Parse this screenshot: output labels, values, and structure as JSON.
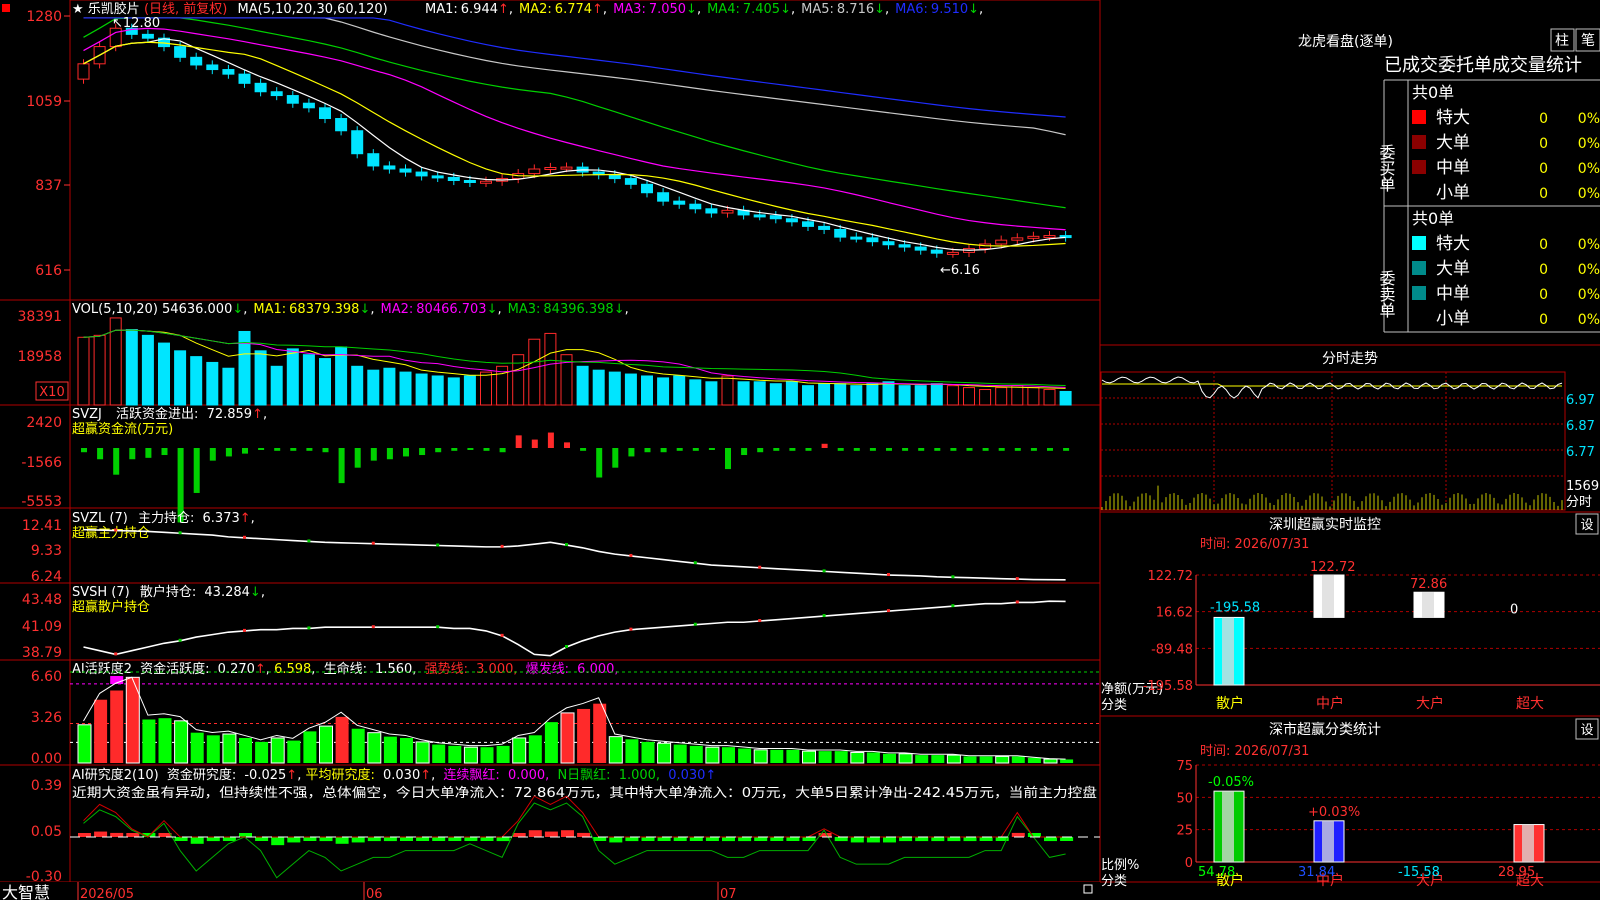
{
  "colors": {
    "up": "#ff2a2a",
    "down": "#00e5ff",
    "grid": "#b00000",
    "axis": "#ff3030",
    "ma1": "#ffffff",
    "ma2": "#ffff00",
    "ma3": "#ff00ff",
    "ma4": "#00d000",
    "ma5": "#c8c8c8",
    "ma6": "#1f2dff",
    "sell_med": "#008b8b",
    "buy_med": "#8b0000"
  },
  "panels": {
    "price": {
      "title_star": "★",
      "stock_name": "乐凯胶片",
      "period_note": "(日线, 前复权)",
      "ma_params": "MA(5,10,20,30,60,120)",
      "ma_values": [
        {
          "label": "MA1:",
          "value": "6.944",
          "arrow": "↑",
          "color": "#ffffff"
        },
        {
          "label": "MA2:",
          "value": "6.774",
          "arrow": "↑",
          "color": "#ffff00"
        },
        {
          "label": "MA3:",
          "value": "7.050",
          "arrow": "↓",
          "color": "#ff00ff"
        },
        {
          "label": "MA4:",
          "value": "7.405",
          "arrow": "↓",
          "color": "#00d000"
        },
        {
          "label": "MA5:",
          "value": "8.716",
          "arrow": "↓",
          "color": "#c8c8c8"
        },
        {
          "label": "MA6:",
          "value": "9.510",
          "arrow": "↓",
          "color": "#1f2dff"
        }
      ],
      "yticks": [
        "1280",
        "1059",
        "837",
        "616"
      ],
      "high_label": "12.80",
      "low_label": "←6.16"
    },
    "vol": {
      "label": "VOL(5,10,20)",
      "value": "54636.000",
      "value_arrow": "↓",
      "ma_values": [
        {
          "label": "MA1:",
          "value": "68379.398",
          "arrow": "↓",
          "color": "#ffff00"
        },
        {
          "label": "MA2:",
          "value": "80466.703",
          "arrow": "↓",
          "color": "#ff00ff"
        },
        {
          "label": "MA3:",
          "value": "84396.398",
          "arrow": "↓",
          "color": "#00d000"
        }
      ],
      "yticks": [
        "38391",
        "18958"
      ],
      "unit_badge": "X10"
    },
    "svzj": {
      "label": "SVZJ",
      "desc": "活跃资金进出:",
      "value": "72.859",
      "arrow": "↑",
      "sub": "超赢资金流(万元)",
      "yticks": [
        "2420",
        "-1566",
        "-5553"
      ]
    },
    "svzl": {
      "label": "SVZL (7)",
      "desc": "主力持仓:",
      "value": "6.373",
      "arrow": "↑",
      "sub": "超赢主力持仓",
      "yticks": [
        "12.41",
        "9.33",
        "6.24"
      ]
    },
    "svsh": {
      "label": "SVSH (7)",
      "desc": "散户持仓:",
      "value": "43.284",
      "arrow": "↓",
      "sub": "超赢散户持仓",
      "yticks": [
        "43.48",
        "41.09",
        "38.79"
      ]
    },
    "ai1": {
      "label": "AI活跃度2",
      "desc": "资金活跃度:",
      "value": "0.270",
      "v2": "6.598",
      "desc3": "生命线:",
      "v3": "1.560",
      "desc4": "强势线:",
      "v4": "3.000",
      "desc5": "爆发线:",
      "v5": "6.000",
      "yticks": [
        "6.60",
        "3.26",
        "0.00"
      ]
    },
    "ai2": {
      "label": "AI研究度2(10)",
      "desc": "资金研究度:",
      "value": "-0.025",
      "desc2": "平均研究度:",
      "v2": "0.030",
      "desc3": "连续飘红:",
      "v3": "0.000",
      "desc4": "N日飘红:",
      "v4": "1.000",
      "v5": "0.030",
      "comment": "近期大资金虽有异动，但持续性不强，总体偏空，今日大单净流入：72.864万元，其中特大单净流入：0万元，大单5日累计净出-242.45万元，当前主力控盘",
      "yticks": [
        "0.39",
        "0.05",
        "-0.30"
      ]
    }
  },
  "xaxis": {
    "brand": "大智慧",
    "labels": [
      "2026/05",
      "06",
      "07"
    ]
  },
  "right": {
    "lhb": {
      "title": "龙虎看盘(逐单)",
      "btn1": "柱",
      "btn2": "笔",
      "subtitle": "已成交委托单成交量统计",
      "buy": {
        "side": "委买单",
        "total": "共0单",
        "rows": [
          {
            "name": "特大",
            "count": "0",
            "pct": "0%",
            "color": "#ff0000"
          },
          {
            "name": "大单",
            "count": "0",
            "pct": "0%",
            "color": "#8b0000"
          },
          {
            "name": "中单",
            "count": "0",
            "pct": "0%",
            "color": "#8b0000"
          },
          {
            "name": "小单",
            "count": "0",
            "pct": "0%",
            "color": ""
          }
        ]
      },
      "sell": {
        "side": "委卖单",
        "total": "共0单",
        "rows": [
          {
            "name": "特大",
            "count": "0",
            "pct": "0%",
            "color": "#00ffff"
          },
          {
            "name": "大单",
            "count": "0",
            "pct": "0%",
            "color": "#008b8b"
          },
          {
            "name": "中单",
            "count": "0",
            "pct": "0%",
            "color": "#008b8b"
          },
          {
            "name": "小单",
            "count": "0",
            "pct": "0%",
            "color": ""
          }
        ]
      }
    },
    "intraday": {
      "title": "分时走势",
      "yticks": [
        "6.97",
        "6.87",
        "6.77"
      ],
      "vol_label": "1569",
      "vol_unit": "分时"
    },
    "monitor": {
      "title": "深圳超赢实时监控",
      "btn": "设",
      "time": "时间: 2026/07/31",
      "yticks": [
        "122.72",
        "16.62",
        "-89.48",
        "-195.58"
      ],
      "ylabel": "净额(万元)",
      "xlabel": "分类",
      "chart_data": {
        "type": "bar",
        "categories": [
          "散户",
          "中户",
          "大户",
          "超大"
        ],
        "values": [
          -195.58,
          122.72,
          72.86,
          0
        ],
        "value_labels": [
          "-195.58",
          "122.72",
          "72.86",
          "0"
        ],
        "ylim": [
          -195.58,
          122.72
        ]
      }
    },
    "classify": {
      "title": "深市超赢分类统计",
      "btn": "设",
      "time": "时间: 2026/07/31",
      "yticks": [
        "75",
        "50",
        "25",
        "0"
      ],
      "ylabel": "比例%",
      "xlabel": "分类",
      "chart_data": {
        "type": "bar",
        "categories": [
          "散户",
          "中户",
          "大户",
          "超大"
        ],
        "values": [
          54.78,
          31.84,
          -15.58,
          28.95
        ],
        "value_labels": [
          "54.78",
          "31.84",
          "-15.58",
          "28.95"
        ],
        "changes": [
          "-0.05%",
          "+0.03%",
          "",
          ""
        ],
        "ylim": [
          0,
          75
        ]
      }
    }
  },
  "chart_data": {
    "type": "candlestick",
    "n": 62,
    "close": [
      1155,
      1200,
      1248,
      1232,
      1222,
      1200,
      1172,
      1152,
      1140,
      1128,
      1104,
      1082,
      1072,
      1052,
      1040,
      1012,
      980,
      920,
      888,
      880,
      872,
      862,
      858,
      850,
      845,
      848,
      855,
      868,
      880,
      884,
      885,
      872,
      865,
      855,
      840,
      818,
      796,
      788,
      776,
      765,
      772,
      760,
      758,
      750,
      742,
      730,
      722,
      702,
      700,
      690,
      682,
      676,
      668,
      660,
      662,
      672,
      684,
      694,
      700,
      704,
      706,
      702
    ],
    "volume": [
      3.5,
      3.6,
      4.5,
      3.9,
      3.6,
      3.2,
      2.8,
      2.5,
      2.2,
      1.9,
      3.8,
      2.8,
      2.0,
      2.9,
      2.6,
      2.4,
      3.0,
      2.0,
      1.8,
      1.9,
      1.7,
      1.6,
      1.5,
      1.4,
      1.5,
      1.7,
      2.0,
      2.6,
      3.4,
      3.7,
      2.6,
      2.0,
      1.8,
      1.7,
      1.6,
      1.5,
      1.4,
      1.5,
      1.3,
      1.2,
      1.5,
      1.2,
      1.2,
      1.1,
      1.2,
      1.0,
      1.1,
      1.1,
      1.0,
      1.1,
      1.2,
      1.0,
      1.0,
      1.1,
      1.0,
      0.9,
      0.8,
      0.9,
      1.0,
      0.9,
      0.8,
      0.7
    ],
    "svzj": [
      -300,
      -800,
      -1900,
      -800,
      -700,
      -500,
      -5300,
      -3200,
      -900,
      -600,
      -400,
      -100,
      -200,
      -200,
      -200,
      -300,
      -2500,
      -1400,
      -900,
      -800,
      -600,
      -500,
      -300,
      -200,
      -100,
      -200,
      -300,
      900,
      600,
      1100,
      400,
      -200,
      -2100,
      -1400,
      -600,
      -300,
      -300,
      -200,
      -200,
      -100,
      -1500,
      -500,
      -300,
      -200,
      -200,
      -200,
      300,
      -200,
      -200,
      -200,
      -200,
      -200,
      -200,
      -200,
      -200,
      -200,
      -200,
      -200,
      -200,
      -200,
      -200,
      -200
    ],
    "svzl": [
      11.9,
      11.85,
      11.8,
      11.75,
      11.7,
      11.6,
      11.5,
      11.4,
      11.3,
      11.1,
      11.0,
      10.9,
      10.8,
      10.7,
      10.6,
      10.5,
      10.45,
      10.4,
      10.35,
      10.3,
      10.25,
      10.2,
      10.15,
      10.1,
      10.05,
      10.0,
      10.0,
      10.1,
      10.3,
      10.5,
      10.2,
      9.9,
      9.5,
      9.2,
      9.0,
      8.8,
      8.6,
      8.4,
      8.2,
      8.0,
      7.9,
      7.8,
      7.7,
      7.6,
      7.5,
      7.4,
      7.3,
      7.2,
      7.1,
      7.0,
      6.9,
      6.85,
      6.8,
      6.7,
      6.65,
      6.6,
      6.55,
      6.5,
      6.45,
      6.4,
      6.38,
      6.37
    ],
    "svsh": [
      39.6,
      39.3,
      39.0,
      39.3,
      39.6,
      39.9,
      40.1,
      40.4,
      40.6,
      40.8,
      40.9,
      41.0,
      41.0,
      41.1,
      41.1,
      41.2,
      41.2,
      41.2,
      41.2,
      41.2,
      41.2,
      41.2,
      41.2,
      41.1,
      41.1,
      40.9,
      40.5,
      39.8,
      39.0,
      38.9,
      39.6,
      40.1,
      40.5,
      40.8,
      41.0,
      41.1,
      41.2,
      41.3,
      41.4,
      41.5,
      41.6,
      41.6,
      41.7,
      41.8,
      41.9,
      42.0,
      42.1,
      42.2,
      42.3,
      42.4,
      42.5,
      42.6,
      42.7,
      42.8,
      42.9,
      43.0,
      43.1,
      43.1,
      43.2,
      43.2,
      43.3,
      43.28
    ],
    "ai1": [
      2.9,
      4.8,
      5.5,
      6.5,
      3.3,
      3.4,
      3.2,
      2.3,
      2.1,
      2.2,
      1.9,
      1.6,
      1.9,
      1.7,
      2.4,
      2.8,
      3.5,
      2.6,
      2.3,
      2.0,
      1.9,
      1.6,
      1.4,
      1.3,
      1.2,
      1.2,
      1.3,
      1.9,
      2.1,
      3.1,
      3.8,
      4.1,
      4.5,
      2.0,
      1.8,
      1.6,
      1.5,
      1.4,
      1.3,
      1.2,
      1.2,
      1.1,
      1.0,
      1.0,
      1.0,
      0.9,
      0.9,
      0.9,
      0.8,
      0.8,
      0.7,
      0.7,
      0.6,
      0.6,
      0.6,
      0.5,
      0.5,
      0.5,
      0.5,
      0.4,
      0.3,
      0.27
    ],
    "ai2": [
      0.02,
      0.04,
      0.03,
      0.01,
      0.0,
      0.02,
      -0.02,
      -0.05,
      -0.03,
      -0.01,
      0.0,
      -0.02,
      -0.06,
      -0.04,
      -0.02,
      -0.03,
      -0.05,
      -0.04,
      -0.03,
      -0.03,
      -0.02,
      -0.02,
      -0.02,
      -0.02,
      -0.01,
      -0.02,
      -0.03,
      0.02,
      0.05,
      0.04,
      0.05,
      0.03,
      -0.02,
      -0.04,
      -0.03,
      -0.02,
      -0.02,
      -0.02,
      -0.02,
      -0.02,
      -0.03,
      -0.03,
      -0.02,
      -0.02,
      -0.02,
      -0.02,
      0.01,
      -0.03,
      -0.04,
      -0.04,
      -0.04,
      -0.03,
      -0.03,
      -0.03,
      -0.03,
      -0.03,
      -0.02,
      -0.02,
      0.03,
      0.0,
      -0.03,
      -0.025
    ]
  }
}
